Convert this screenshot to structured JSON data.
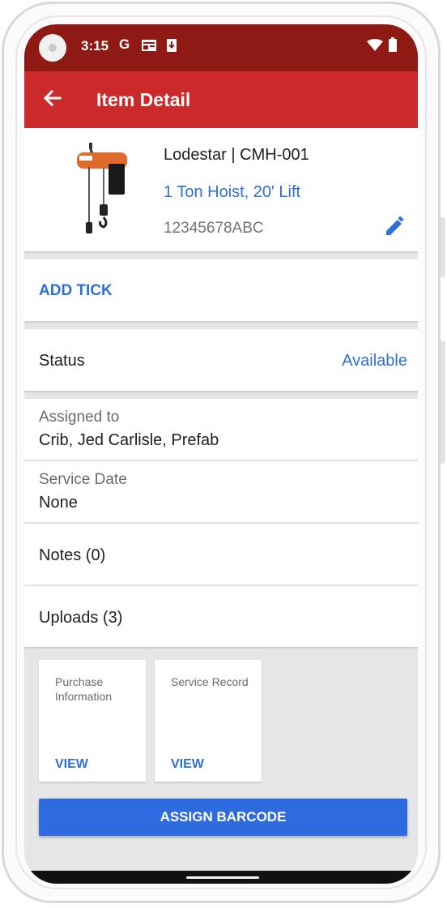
{
  "statusbar": {
    "time": "3:15",
    "icons": [
      "google-icon",
      "news-icon",
      "download-icon",
      "wifi-icon",
      "battery-icon"
    ],
    "google_glyph": "G"
  },
  "appbar": {
    "title": "Item Detail",
    "back_icon": "arrow-back-icon"
  },
  "item": {
    "name": "Lodestar | CMH-001",
    "description": "1 Ton Hoist, 20' Lift",
    "serial": "12345678ABC",
    "image": "chain-hoist-image",
    "edit_icon": "pencil-icon"
  },
  "actions": {
    "add_tick": "ADD TICK"
  },
  "status": {
    "label": "Status",
    "value": "Available"
  },
  "assigned": {
    "label": "Assigned to",
    "value": "Crib, Jed Carlisle, Prefab"
  },
  "service": {
    "label": "Service Date",
    "value": "None"
  },
  "notes": {
    "label": "Notes (0)"
  },
  "uploads": {
    "label": "Uploads (3)",
    "tiles": [
      {
        "title": "Purchase Information",
        "action": "VIEW"
      },
      {
        "title": "Service Record",
        "action": "VIEW"
      }
    ]
  },
  "footer": {
    "assign_label": "ASSIGN BARCODE"
  },
  "colors": {
    "statusbar": "#8e1a13",
    "appbar": "#cc2a2a",
    "accent": "#2f6fd6",
    "button": "#2f6be0",
    "background": "#e6e6e6"
  }
}
